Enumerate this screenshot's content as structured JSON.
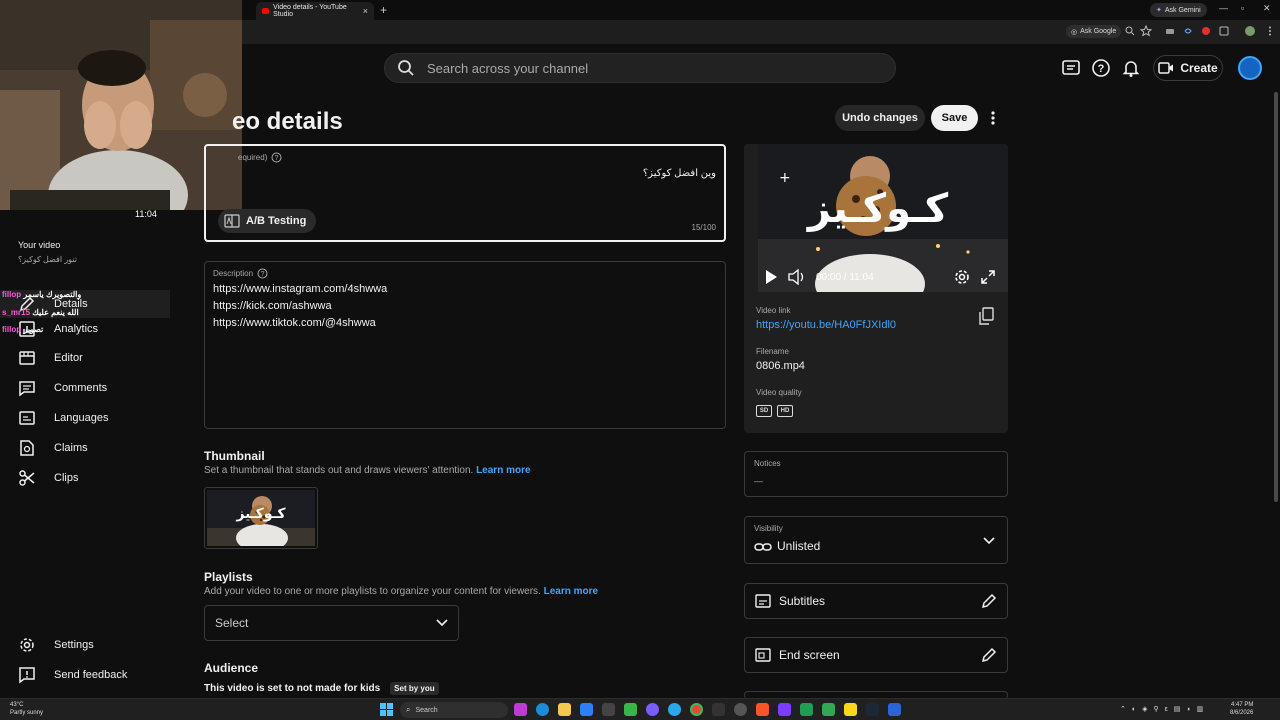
{
  "browser": {
    "tab_title": "Video details - YouTube Studio",
    "tab_close": "×",
    "new_tab": "+",
    "ask_gemini": "Ask Gemini",
    "ask_google": "Ask Google",
    "window_min": "—",
    "window_max": "▫",
    "window_close": "✕"
  },
  "header": {
    "search_placeholder": "Search across your channel",
    "create_label": "Create"
  },
  "webcam": {
    "duration": "11:04"
  },
  "sidebar": {
    "your_video_label": "Your video",
    "video_title": "تنور افضل كوكيز؟",
    "items": [
      {
        "label": "Details",
        "icon": "pencil-icon"
      },
      {
        "label": "Analytics",
        "icon": "analytics-icon"
      },
      {
        "label": "Editor",
        "icon": "editor-icon"
      },
      {
        "label": "Comments",
        "icon": "comments-icon"
      },
      {
        "label": "Languages",
        "icon": "languages-icon"
      },
      {
        "label": "Claims",
        "icon": "claims-icon"
      },
      {
        "label": "Clips",
        "icon": "scissors-icon"
      }
    ],
    "settings_label": "Settings",
    "feedback_label": "Send feedback"
  },
  "chat": [
    {
      "user": "fillop",
      "message": "والتصويرك ياسمر"
    },
    {
      "user": "s_mr15",
      "message": "الله ينعم عليك"
    },
    {
      "user": "fillop",
      "message": "تصوير"
    }
  ],
  "page": {
    "title": "eo details",
    "undo_label": "Undo changes",
    "save_label": "Save"
  },
  "title_field": {
    "label": "equired)",
    "value": "وين افضل كوكيز؟",
    "ab_label": "A/B Testing",
    "count": "15/100"
  },
  "description": {
    "label": "Description",
    "lines": [
      "https://www.instagram.com/4shwwa",
      "https://kick.com/ashwwa",
      "https://www.tiktok.com/@4shwwa"
    ]
  },
  "thumbnail": {
    "heading": "Thumbnail",
    "subtitle": "Set a thumbnail that stands out and draws viewers' attention.",
    "learn_more": "Learn more",
    "overlay_text": "كـوكـيز"
  },
  "playlists": {
    "heading": "Playlists",
    "subtitle": "Add your video to one or more playlists to organize your content for viewers.",
    "learn_more": "Learn more",
    "select_label": "Select"
  },
  "audience": {
    "heading": "Audience",
    "text": "This video is set to not made for kids",
    "badge": "Set by you"
  },
  "preview": {
    "overlay_text": "كـوكـيز",
    "time": "00:00 / 11:04",
    "video_link_label": "Video link",
    "video_link": "https://youtu.be/HA0FfJXIdl0",
    "filename_label": "Filename",
    "filename": "0806.mp4",
    "quality_label": "Video quality",
    "quality_sd": "SD",
    "quality_hd": "HD"
  },
  "notices": {
    "label": "Notices",
    "value": "—"
  },
  "visibility": {
    "label": "Visibility",
    "value": "Unlisted"
  },
  "subtitles_label": "Subtitles",
  "endscreen_label": "End screen",
  "taskbar": {
    "weather_temp": "43°C",
    "weather_desc": "Partly sunny",
    "search_label": "Search",
    "time": "4:47 PM",
    "date": "8/6/2026"
  },
  "colors": {
    "accent_blue": "#3ea6ff",
    "background": "#0f0f0f",
    "chat_user": "#ff57d8"
  }
}
